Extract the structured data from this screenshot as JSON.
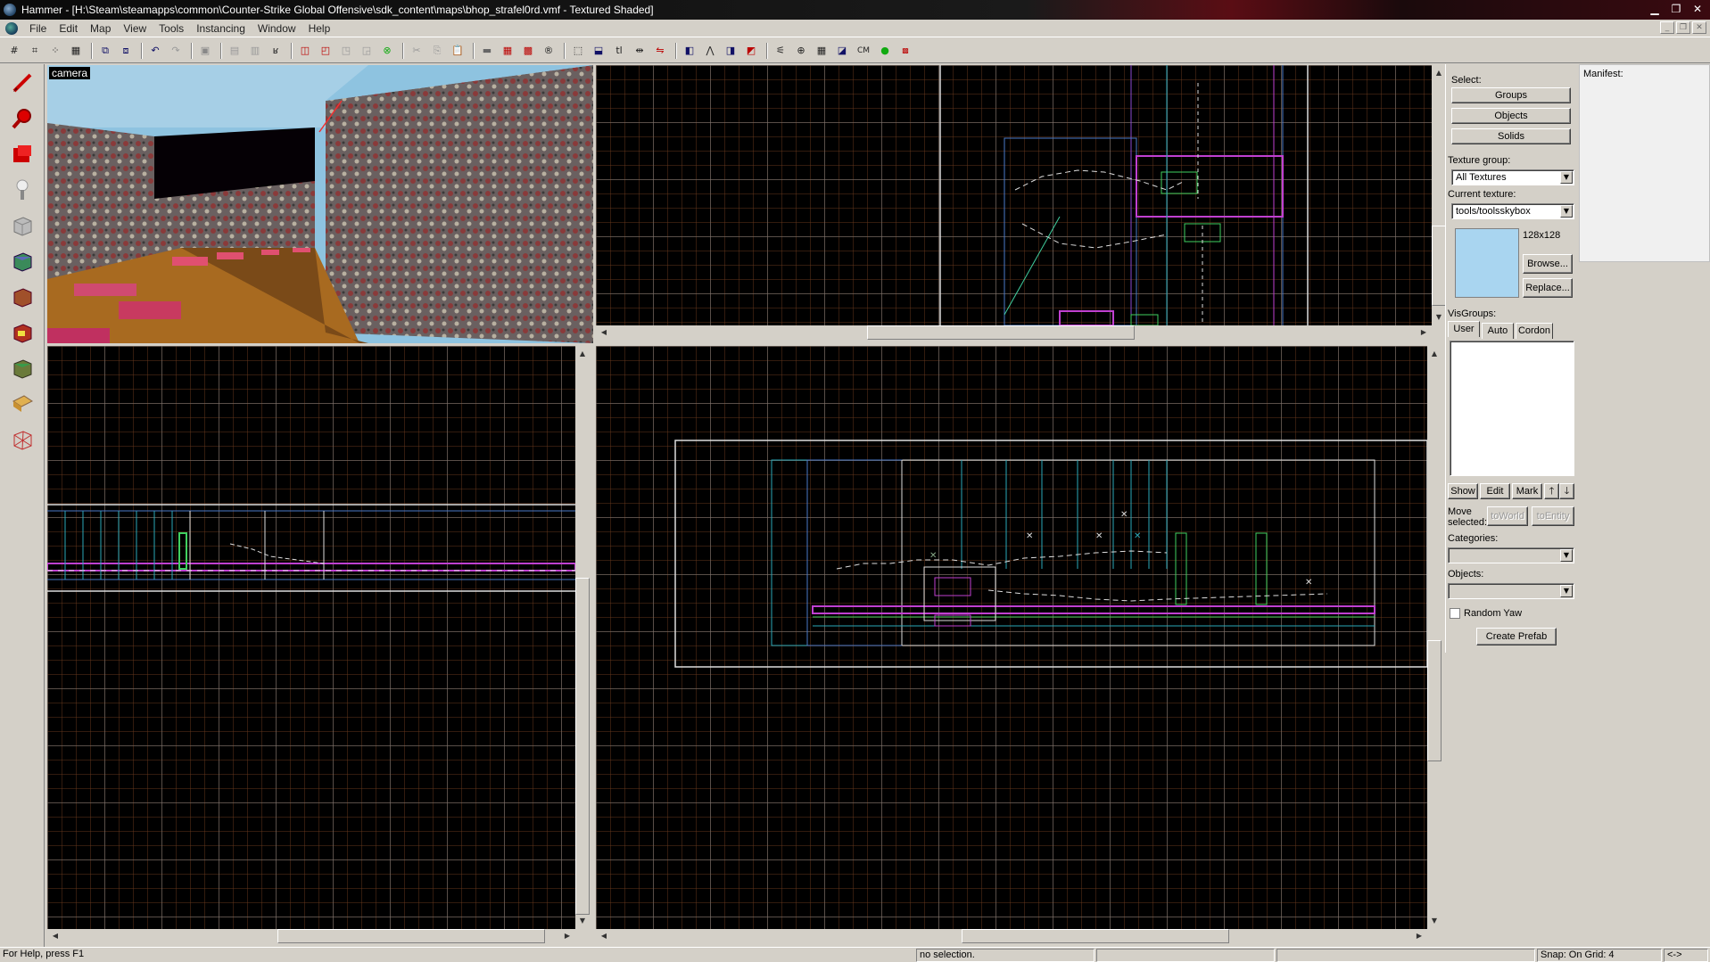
{
  "window": {
    "title": "Hammer - [H:\\Steam\\steamapps\\common\\Counter-Strike Global Offensive\\sdk_content\\maps\\bhop_strafel0rd.vmf - Textured Shaded]",
    "buttons": [
      "minimize",
      "restore",
      "close"
    ]
  },
  "menu": {
    "items": [
      "File",
      "Edit",
      "Map",
      "View",
      "Tools",
      "Instancing",
      "Window",
      "Help"
    ]
  },
  "toolbar": {
    "cm_label": "CM",
    "items": [
      "grid-toggle-icon",
      "grid-3d-icon",
      "dotted-grid-icon",
      "smaller-grid-icon",
      "larger-grid-icon",
      "group-icon",
      "ungroup-icon",
      "undo-icon",
      "redo-icon",
      "carve-icon",
      "hollow-icon",
      "texture-lock-icon",
      "hide-icon",
      "cut-icon",
      "copy-icon",
      "paste-icon",
      "selection-mode-icon",
      "autosize-icon",
      "overlay-icon",
      "radius-icon",
      "toolbar-cm",
      "run-map-icon",
      "draw-toggle-icon"
    ]
  },
  "tools": [
    "selection-tool-icon",
    "magnify-tool-icon",
    "camera-tool-icon",
    "entity-tool-icon",
    "block-tool-icon",
    "texture-application-icon",
    "apply-texture-icon",
    "decal-tool-icon",
    "overlay-tool-icon",
    "clip-tool-icon",
    "vertex-tool-icon",
    "path-tool-icon"
  ],
  "viewports": {
    "camera_label": "camera"
  },
  "panel": {
    "select_label": "Select:",
    "groups_button": "Groups",
    "objects_button": "Objects",
    "solids_button": "Solids",
    "texture_group_label": "Texture group:",
    "texture_group_value": "All Textures",
    "current_texture_label": "Current texture:",
    "current_texture_value": "tools/toolsskybox",
    "texture_size": "128x128",
    "browse_button": "Browse...",
    "replace_button": "Replace...",
    "visgroups_label": "VisGroups:",
    "tabs": [
      "User",
      "Auto",
      "Cordon"
    ],
    "show_button": "Show",
    "edit_button": "Edit",
    "mark_button": "Mark",
    "move_selected_label_1": "Move",
    "move_selected_label_2": "selected:",
    "toworld_button": "toWorld",
    "toentity_button": "toEntity",
    "categories_label": "Categories:",
    "objects_label": "Objects:",
    "random_yaw_label": "Random Yaw",
    "create_prefab_button": "Create Prefab",
    "manifest_label": "Manifest:"
  },
  "status": {
    "help": "For Help, press F1",
    "selection": "no selection.",
    "snap": "Snap: On Grid: 4",
    "arrows": "<->"
  },
  "colors": {
    "selection_blue": "#4a7ac8",
    "cyan_brush": "#2aa8b8",
    "magenta_brush": "#c040d0",
    "green_brush": "#40d060",
    "grid": "#787878"
  }
}
